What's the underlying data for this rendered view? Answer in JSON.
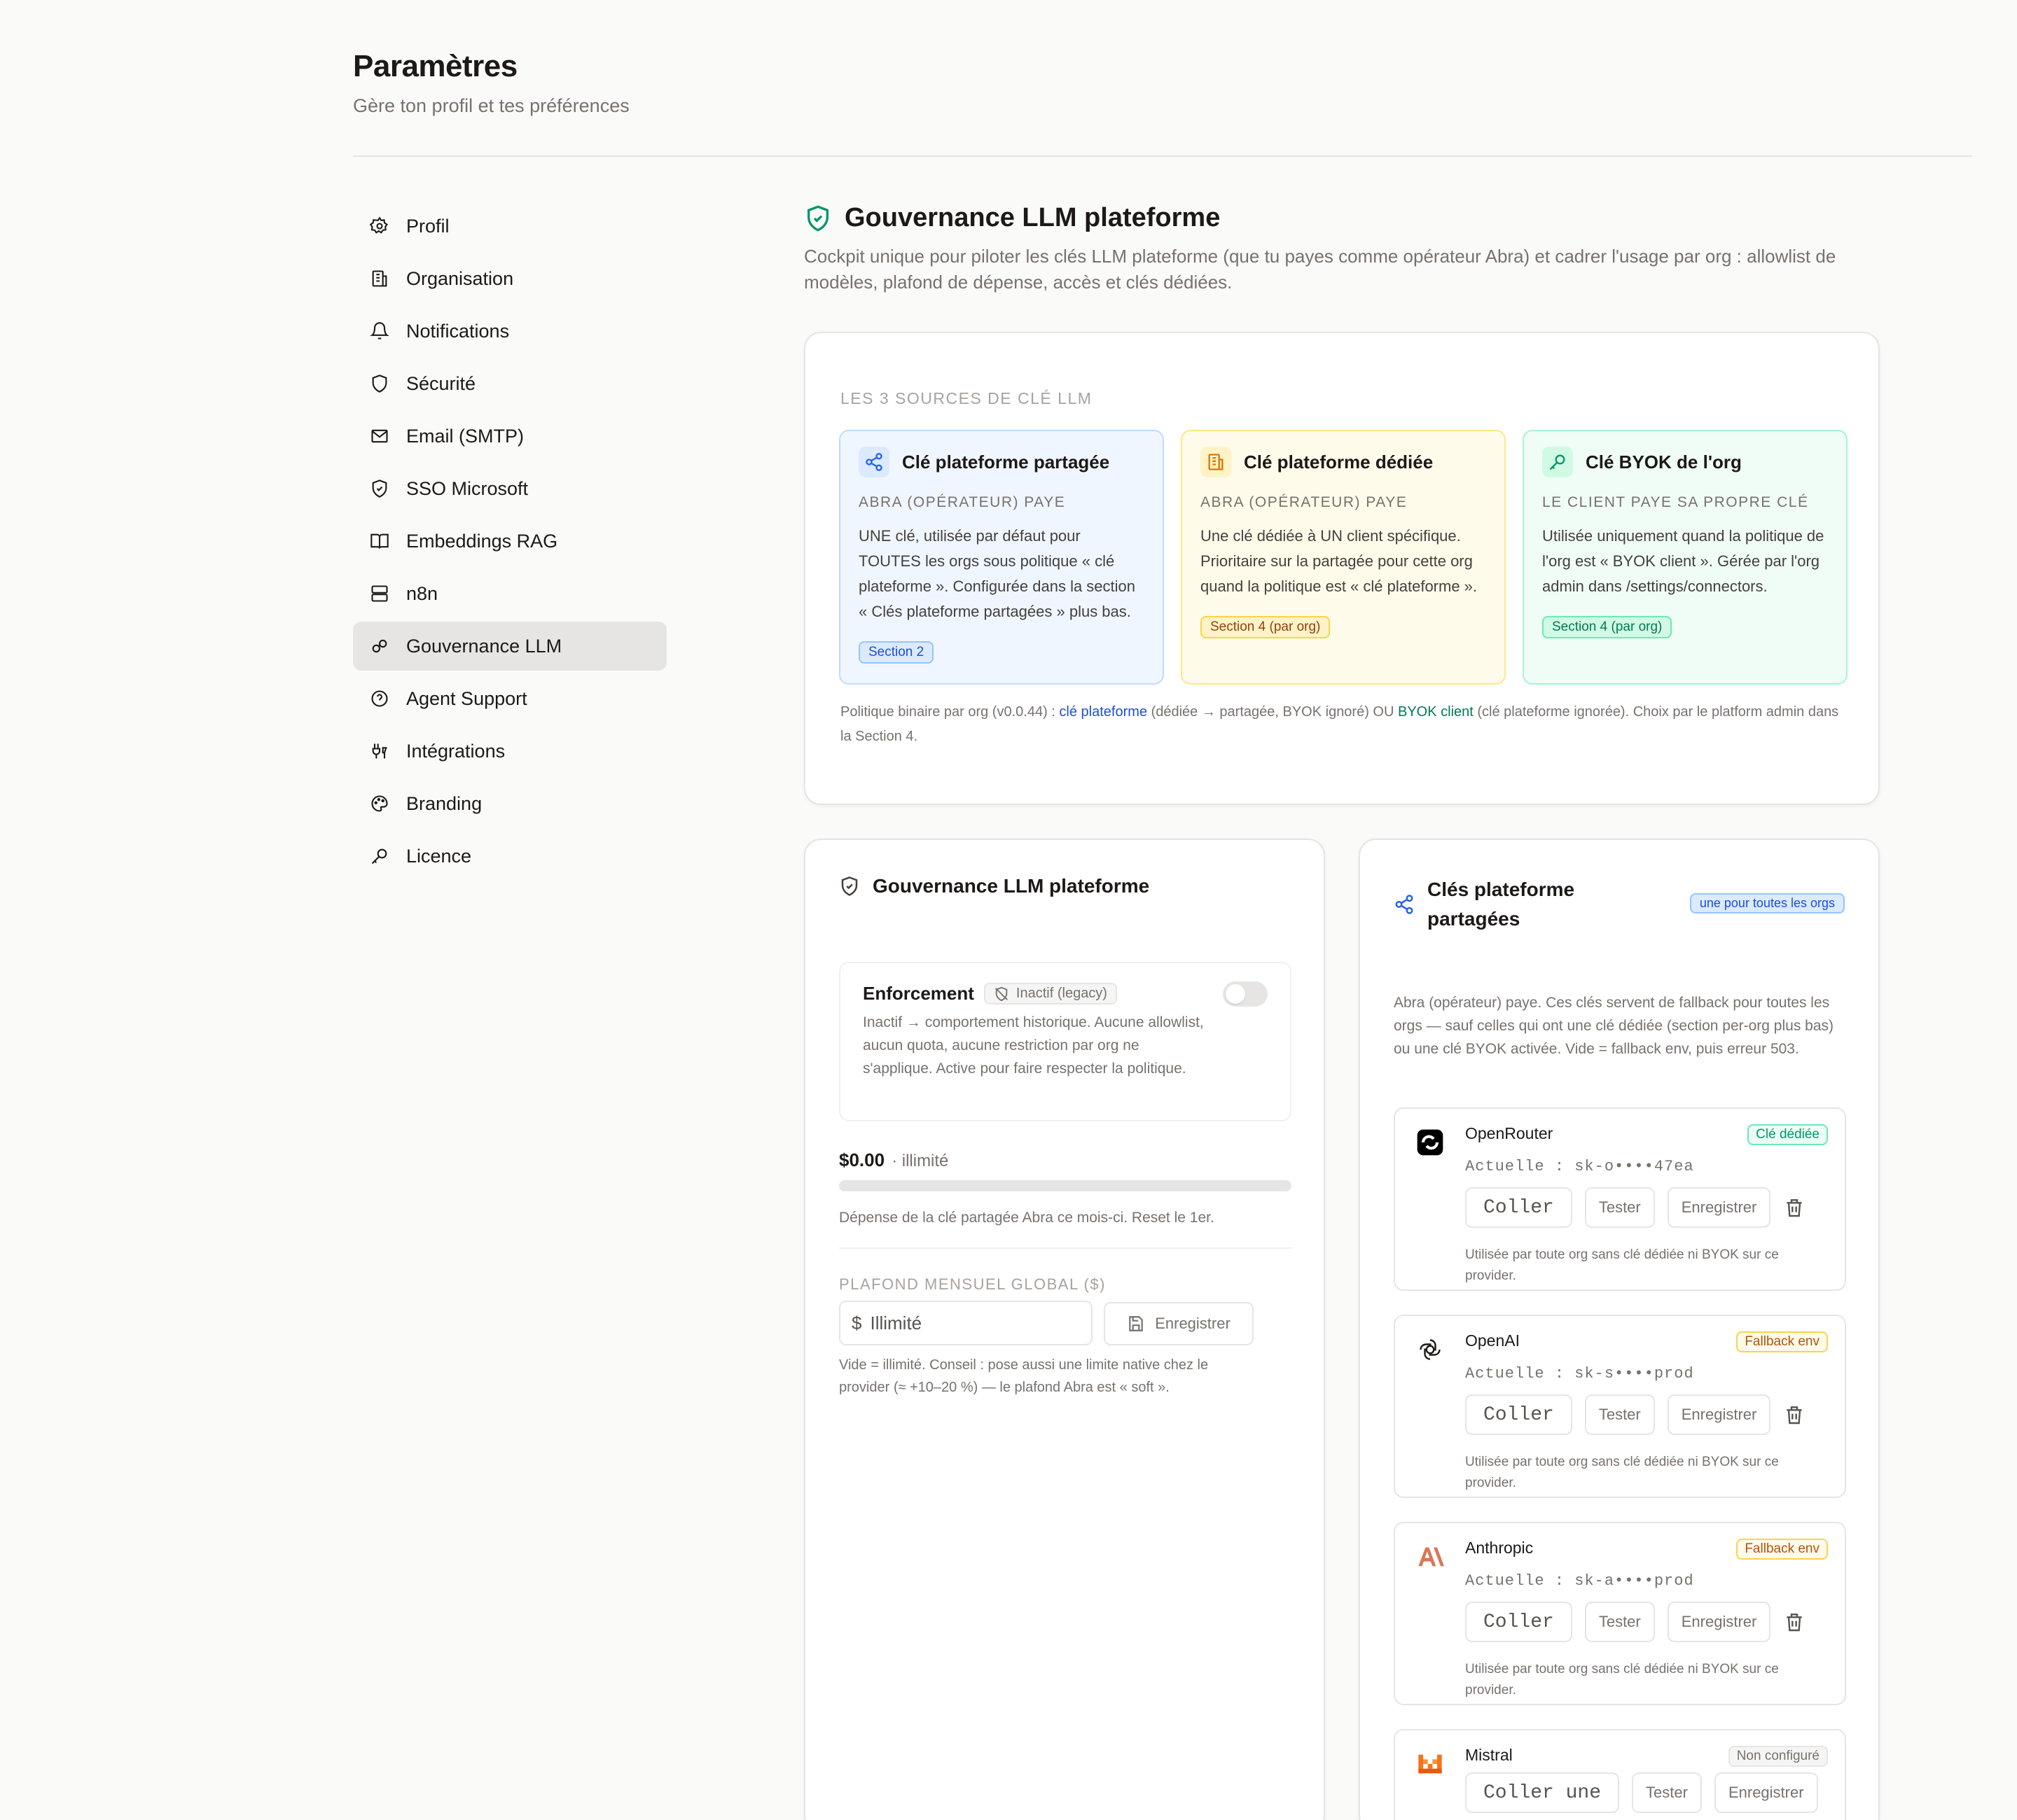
{
  "header": {
    "title": "Paramètres",
    "subtitle": "Gère ton profil et tes préférences"
  },
  "nav": [
    {
      "label": "Profil",
      "icon": "gear-icon"
    },
    {
      "label": "Organisation",
      "icon": "building-icon"
    },
    {
      "label": "Notifications",
      "icon": "bell-icon"
    },
    {
      "label": "Sécurité",
      "icon": "shield-icon"
    },
    {
      "label": "Email (SMTP)",
      "icon": "mail-icon"
    },
    {
      "label": "SSO Microsoft",
      "icon": "shield-check-icon"
    },
    {
      "label": "Embeddings RAG",
      "icon": "book-icon"
    },
    {
      "label": "n8n",
      "icon": "server-icon"
    },
    {
      "label": "Gouvernance LLM",
      "icon": "link-icon",
      "active": true
    },
    {
      "label": "Agent Support",
      "icon": "help-circle-icon"
    },
    {
      "label": "Intégrations",
      "icon": "plug-icon"
    },
    {
      "label": "Branding",
      "icon": "palette-icon"
    },
    {
      "label": "Licence",
      "icon": "key-icon"
    }
  ],
  "section": {
    "title": "Gouvernance LLM plateforme",
    "description": "Cockpit unique pour piloter les clés LLM plateforme (que tu payes comme opérateur Abra) et cadrer l'usage par org : allowlist de modèles, plafond de dépense, accès et clés dédiées."
  },
  "sources": {
    "overline": "LES 3 SOURCES DE CLÉ LLM",
    "shared": {
      "title": "Clé plateforme partagée",
      "who": "ABRA (OPÉRATEUR) PAYE",
      "body": "UNE clé, utilisée par défaut pour TOUTES les orgs sous politique « clé plateforme ». Configurée dans la section « Clés plateforme partagées » plus bas.",
      "badge": "Section 2",
      "color": "#3b82f6"
    },
    "dedicated": {
      "title": "Clé plateforme dédiée",
      "who": "ABRA (OPÉRATEUR) PAYE",
      "body": "Une clé dédiée à UN client spécifique. Prioritaire sur la partagée pour cette org quand la politique est « clé plateforme ».",
      "badge": "Section 4 (par org)",
      "color": "#f59e0b"
    },
    "byok": {
      "title": "Clé BYOK de l'org",
      "who": "LE CLIENT PAYE SA PROPRE CLÉ",
      "body": "Utilisée uniquement quand la politique de l'org est « BYOK client ». Gérée par l'org admin dans /settings/connectors.",
      "badge": "Section 4 (par org)",
      "color": "#10b981"
    },
    "note_a": "Politique binaire par org (v0.0.44) : ",
    "note_link1": "clé plateforme",
    "note_b": " (dédiée → partagée, BYOK ignoré) OU ",
    "note_link2": "BYOK client",
    "note_c": " (clé plateforme ignorée). Choix par le platform admin dans la Section 4."
  },
  "governance": {
    "title": "Gouvernance LLM plateforme",
    "enforcement_label": "Enforcement",
    "enforcement_badge": "Inactif (legacy)",
    "enforcement_on": false,
    "enforcement_desc": "Inactif → comportement historique. Aucune allowlist, aucun quota, aucune restriction par org ne s'applique. Active pour faire respecter la politique.",
    "spend_amount": "$0.00",
    "spend_suffix": "· illimité",
    "spend_fraction": 0,
    "spend_desc": "Dépense de la clé partagée Abra ce mois-ci. Reset le 1er.",
    "cap_label": "PLAFOND MENSUEL GLOBAL ($)",
    "cap_prefix": "$",
    "cap_placeholder": "Illimité",
    "save_label": "Enregistrer",
    "cap_help": "Vide = illimité. Conseil : pose aussi une limite native chez le provider (≈ +10–20 %) — le plafond Abra est « soft »."
  },
  "shared_keys": {
    "title": "Clés plateforme partagées",
    "badge": "une pour toutes les orgs",
    "description": "Abra (opérateur) paye. Ces clés servent de fallback pour toutes les orgs — sauf celles qui ont une clé dédiée (section per-org plus bas) ou une clé BYOK activée. Vide = fallback env, puis erreur 503.",
    "providers": [
      {
        "name": "OpenRouter",
        "tag": "Clé dédiée",
        "tag_color": "#059669",
        "current": "Actuelle : sk-o••••47ea",
        "paste": "Coller",
        "test": "Tester",
        "save": "Enregistrer",
        "help": "Utilisée par toute org sans clé dédiée ni BYOK sur ce provider.",
        "logo": "openrouter-logo-icon"
      },
      {
        "name": "OpenAI",
        "tag": "Fallback env",
        "tag_color": "#d97706",
        "current": "Actuelle : sk-s••••prod",
        "paste": "Coller",
        "test": "Tester",
        "save": "Enregistrer",
        "help": "Utilisée par toute org sans clé dédiée ni BYOK sur ce provider.",
        "logo": "openai-logo-icon"
      },
      {
        "name": "Anthropic",
        "tag": "Fallback env",
        "tag_color": "#d97706",
        "current": "Actuelle : sk-a••••prod",
        "paste": "Coller",
        "test": "Tester",
        "save": "Enregistrer",
        "help": "Utilisée par toute org sans clé dédiée ni BYOK sur ce provider.",
        "logo": "anthropic-logo-icon"
      },
      {
        "name": "Mistral",
        "tag": "Non configuré",
        "tag_color": "#78716c",
        "paste": "Coller une",
        "test": "Tester",
        "save": "Enregistrer",
        "logo": "mistral-logo-icon"
      }
    ]
  }
}
